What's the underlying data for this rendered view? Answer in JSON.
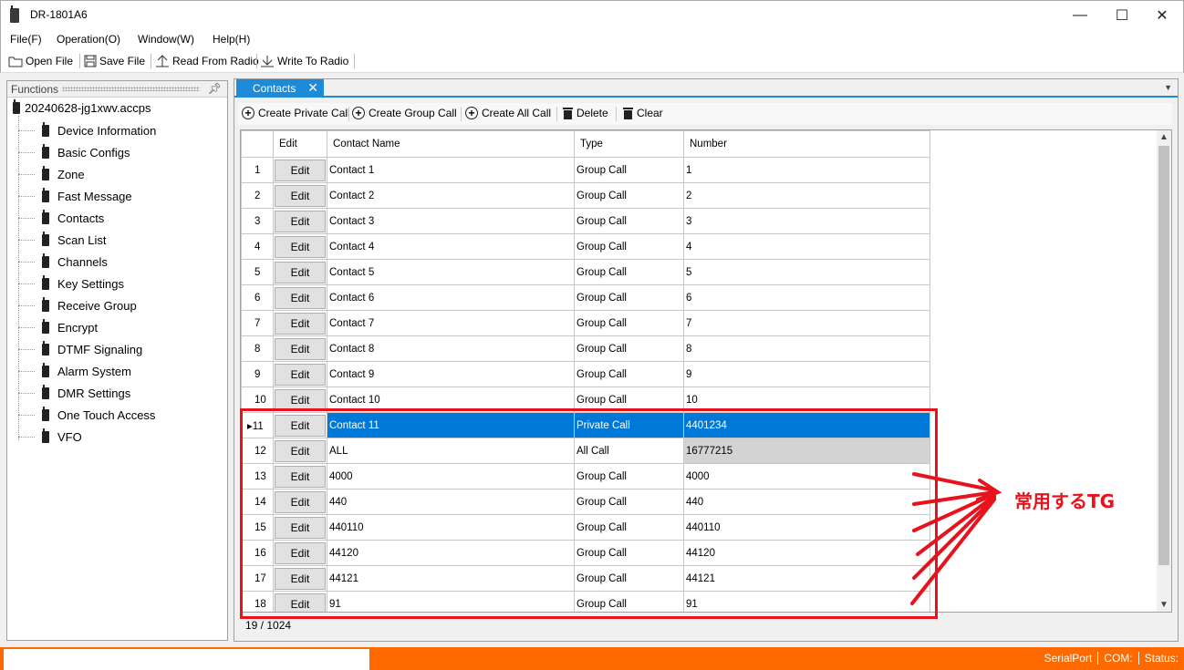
{
  "window": {
    "title": "DR-1801A6",
    "minimize": "—",
    "maximize": "☐",
    "close": "✕"
  },
  "menu": [
    "File(F)",
    "Operation(O)",
    "Window(W)",
    "Help(H)"
  ],
  "toolbar": {
    "open": "Open File",
    "save": "Save File",
    "read": "Read From Radio",
    "write": "Write To Radio"
  },
  "functions": {
    "header": "Functions",
    "root": "20240628-jg1xwv.accps",
    "items": [
      "Device Information",
      "Basic Configs",
      "Zone",
      "Fast Message",
      "Contacts",
      "Scan List",
      "Channels",
      "Key Settings",
      "Receive Group",
      "Encrypt",
      "DTMF Signaling",
      "Alarm System",
      "DMR Settings",
      "One Touch Access",
      "VFO"
    ]
  },
  "tab": {
    "label": "Contacts",
    "close": "✕"
  },
  "actions": {
    "private": "Create Private Call",
    "group": "Create Group Call",
    "all": "Create All Call",
    "delete": "Delete",
    "clear": "Clear"
  },
  "grid": {
    "headers": {
      "edit": "Edit",
      "name": "Contact Name",
      "type": "Type",
      "number": "Number"
    },
    "edit_label": "Edit",
    "rows": [
      {
        "n": "1",
        "name": "Contact 1",
        "type": "Group Call",
        "number": "1"
      },
      {
        "n": "2",
        "name": "Contact 2",
        "type": "Group Call",
        "number": "2"
      },
      {
        "n": "3",
        "name": "Contact 3",
        "type": "Group Call",
        "number": "3"
      },
      {
        "n": "4",
        "name": "Contact 4",
        "type": "Group Call",
        "number": "4"
      },
      {
        "n": "5",
        "name": "Contact 5",
        "type": "Group Call",
        "number": "5"
      },
      {
        "n": "6",
        "name": "Contact 6",
        "type": "Group Call",
        "number": "6"
      },
      {
        "n": "7",
        "name": "Contact 7",
        "type": "Group Call",
        "number": "7"
      },
      {
        "n": "8",
        "name": "Contact 8",
        "type": "Group Call",
        "number": "8"
      },
      {
        "n": "9",
        "name": "Contact 9",
        "type": "Group Call",
        "number": "9"
      },
      {
        "n": "10",
        "name": "Contact 10",
        "type": "Group Call",
        "number": "10"
      },
      {
        "n": "11",
        "name": "Contact 11",
        "type": "Private Call",
        "number": "4401234"
      },
      {
        "n": "12",
        "name": "ALL",
        "type": "All Call",
        "number": "16777215"
      },
      {
        "n": "13",
        "name": "4000",
        "type": "Group Call",
        "number": "4000"
      },
      {
        "n": "14",
        "name": "440",
        "type": "Group Call",
        "number": "440"
      },
      {
        "n": "15",
        "name": "440110",
        "type": "Group Call",
        "number": "440110"
      },
      {
        "n": "16",
        "name": "44120",
        "type": "Group Call",
        "number": "44120"
      },
      {
        "n": "17",
        "name": "44121",
        "type": "Group Call",
        "number": "44121"
      },
      {
        "n": "18",
        "name": "91",
        "type": "Group Call",
        "number": "91"
      }
    ],
    "selected_row": "11",
    "count": "19 / 1024"
  },
  "annotation": "常用するTG",
  "status": {
    "port": "SerialPort",
    "com": "COM:",
    "status": "Status:"
  },
  "colors": {
    "accent": "#0078d7",
    "status_bar": "#ff6a00",
    "annotation": "#e8121d"
  }
}
